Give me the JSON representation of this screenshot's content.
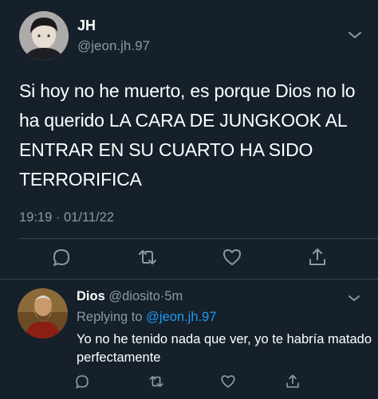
{
  "tweet": {
    "author_name": "JH",
    "author_handle": "@jeon.jh.97",
    "text": "Si hoy no he muerto, es porque Dios no lo ha querido LA CARA DE JUNGKOOK AL ENTRAR EN SU CUARTO HA SIDO TERRORIFICA",
    "time": "19:19",
    "date": "01/11/22",
    "meta_separator": "·"
  },
  "reply": {
    "author_name": "Dios",
    "author_handle": "@diosito",
    "age": "5m",
    "replying_prefix": "Replying to",
    "replying_to": "@jeon.jh.97",
    "text": "Yo no he tenido nada que ver, yo te habría matado perfectamente"
  },
  "icons": {
    "more": "chevron-down-icon",
    "reply": "comment-icon",
    "retweet": "retweet-icon",
    "like": "heart-icon",
    "share": "share-icon"
  },
  "colors": {
    "background": "#15202b",
    "secondary_text": "#8b98a5",
    "link": "#1d9bf0",
    "divider": "#38444d"
  }
}
